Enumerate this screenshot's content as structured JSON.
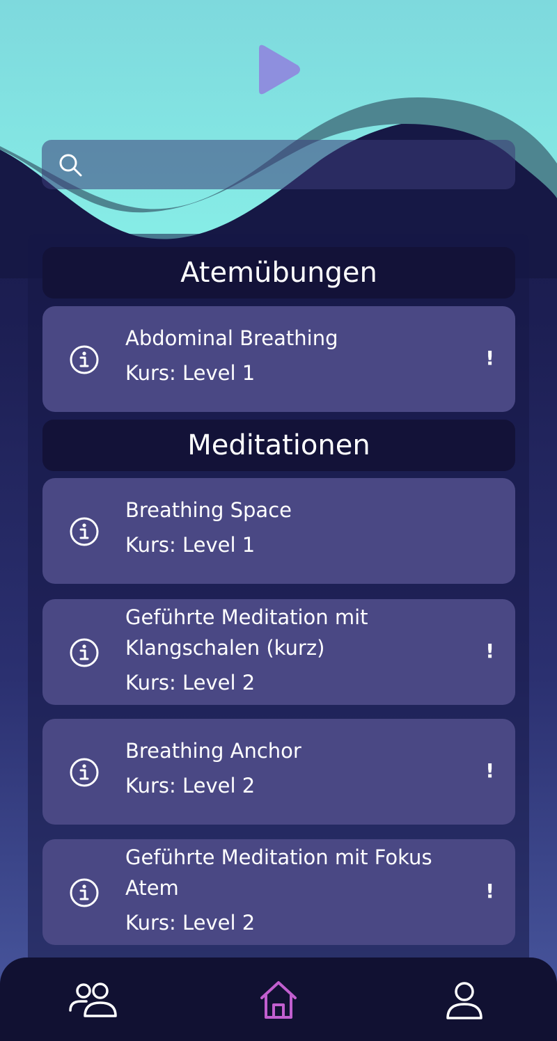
{
  "header": {
    "play_icon": "play-icon",
    "colors": {
      "sky": "#86ece6",
      "wave": "#4e8590",
      "play": "#8e8fde"
    }
  },
  "search": {
    "icon": "search-icon",
    "placeholder": "",
    "value": ""
  },
  "sections": [
    {
      "title": "Atemübungen",
      "items": [
        {
          "title": "Abdominal Breathing",
          "level": "Kurs: Level 1",
          "alert": "!"
        }
      ]
    },
    {
      "title": "Meditationen",
      "items": [
        {
          "title": "Breathing Space",
          "level": "Kurs: Level 1",
          "alert": ""
        },
        {
          "title": "Geführte Meditation mit Klangschalen (kurz)",
          "level": "Kurs: Level 2",
          "alert": "!"
        },
        {
          "title": "Breathing Anchor",
          "level": "Kurs: Level 2",
          "alert": "!"
        },
        {
          "title": "Geführte Meditation mit Fokus Atem",
          "level": "Kurs: Level 2",
          "alert": "!"
        }
      ]
    }
  ],
  "bottom_nav": {
    "items": [
      {
        "icon": "community-icon",
        "active": false
      },
      {
        "icon": "home-icon",
        "active": true
      },
      {
        "icon": "profile-icon",
        "active": false
      }
    ],
    "active_color": "#c15fcf"
  }
}
